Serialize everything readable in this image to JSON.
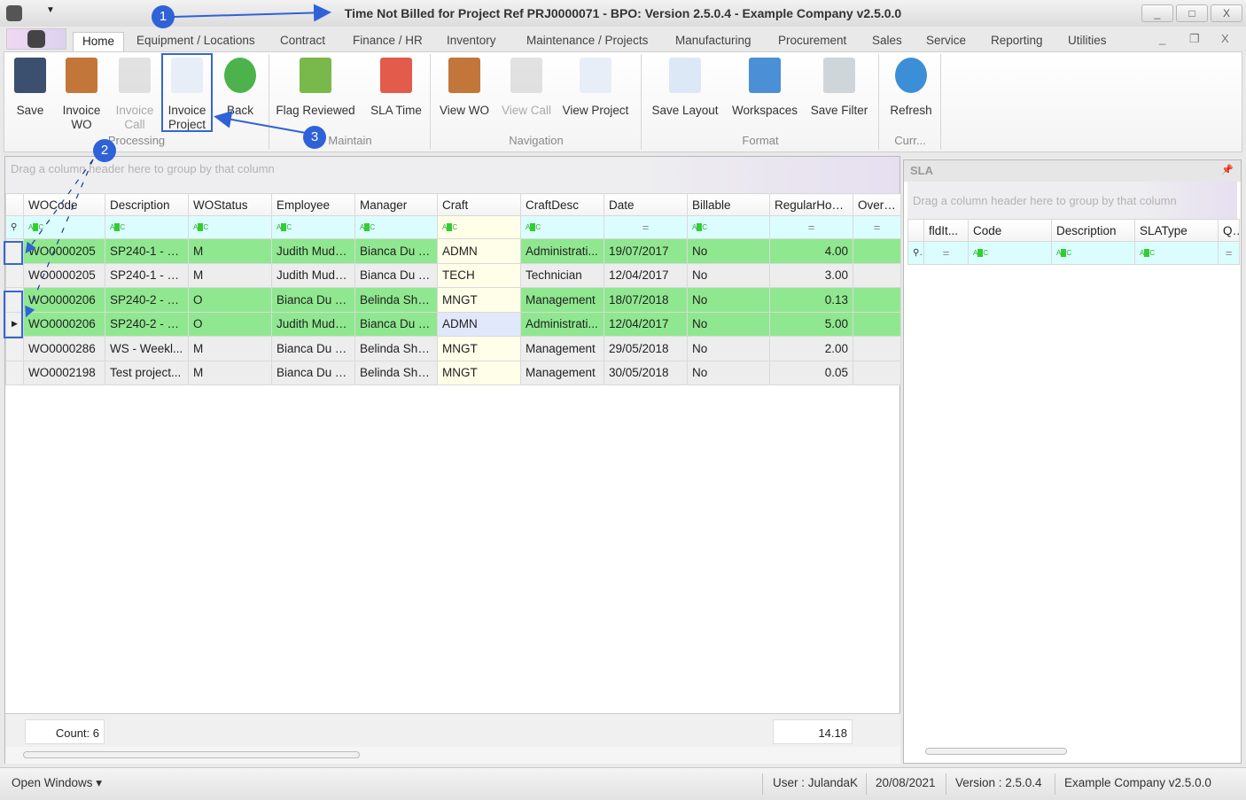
{
  "window": {
    "title": "Time Not Billed for Project Ref PRJ0000071 - BPO: Version 2.5.0.4 - Example Company v2.5.0.0",
    "min": "_",
    "max": "□",
    "close": "X"
  },
  "tabs": [
    "Home",
    "Equipment / Locations",
    "Contract",
    "Finance / HR",
    "Inventory",
    "Maintenance / Projects",
    "Manufacturing",
    "Procurement",
    "Sales",
    "Service",
    "Reporting",
    "Utilities"
  ],
  "ribbon": {
    "buttons": [
      {
        "label": "Save"
      },
      {
        "label": "Invoice WO"
      },
      {
        "label": "Invoice Call",
        "disabled": true
      },
      {
        "label": "Invoice Project"
      },
      {
        "label": "Back"
      },
      {
        "label": "Flag Reviewed"
      },
      {
        "label": "SLA Time"
      },
      {
        "label": "View WO"
      },
      {
        "label": "View Call",
        "disabled": true
      },
      {
        "label": "View Project"
      },
      {
        "label": "Save Layout"
      },
      {
        "label": "Workspaces"
      },
      {
        "label": "Save Filter"
      },
      {
        "label": "Refresh"
      }
    ],
    "groups": [
      "Processing",
      "Maintain",
      "Navigation",
      "Format",
      "Curr..."
    ]
  },
  "grid": {
    "group_hint": "Drag a column header here to group by that column",
    "columns": [
      "WOCode",
      "Description",
      "WOStatus",
      "Employee",
      "Manager",
      "Craft",
      "CraftDesc",
      "Date",
      "Billable",
      "RegularHours",
      "Overtim"
    ],
    "rows": [
      [
        "WO0000205",
        "SP240-1 - M...",
        "M",
        "Judith Mudz...",
        "Bianca Du T...",
        "ADMN",
        "Administrati...",
        "19/07/2017",
        "No",
        "4.00",
        ""
      ],
      [
        "WO0000205",
        "SP240-1 - M...",
        "M",
        "Judith Mudz...",
        "Bianca Du T...",
        "TECH",
        "Technician",
        "12/04/2017",
        "No",
        "3.00",
        ""
      ],
      [
        "WO0000206",
        "SP240-2 - N...",
        "O",
        "Bianca Du T...",
        "Belinda Sha...",
        "MNGT",
        "Management",
        "18/07/2018",
        "No",
        "0.13",
        ""
      ],
      [
        "WO0000206",
        "SP240-2 - N...",
        "O",
        "Judith Mudz...",
        "Bianca Du T...",
        "ADMN",
        "Administrati...",
        "12/04/2017",
        "No",
        "5.00",
        ""
      ],
      [
        "WO0000286",
        "WS - Weekl...",
        "M",
        "Bianca Du T...",
        "Belinda Sha...",
        "MNGT",
        "Management",
        "29/05/2018",
        "No",
        "2.00",
        ""
      ],
      [
        "WO0002198",
        "Test project...",
        "M",
        "Bianca Du T...",
        "Belinda Sha...",
        "MNGT",
        "Management",
        "30/05/2018",
        "No",
        "0.05",
        ""
      ]
    ],
    "row_highlight": [
      true,
      false,
      true,
      true,
      false,
      false
    ],
    "count": "Count: 6",
    "total": "14.18"
  },
  "sla": {
    "title": "SLA",
    "group_hint": "Drag a column header here to group by that column",
    "columns": [
      "fldIt...",
      "Code",
      "Description",
      "SLAType",
      "Qu"
    ]
  },
  "status": {
    "open_windows": "Open Windows",
    "user": "User : JulandaK",
    "date": "20/08/2021",
    "version": "Version : 2.5.0.4",
    "company": "Example Company v2.5.0.0"
  },
  "annotations": [
    "1",
    "2",
    "3"
  ],
  "colors": {
    "highlight_row": "#8fe88f",
    "annotation": "#2f62d7"
  }
}
